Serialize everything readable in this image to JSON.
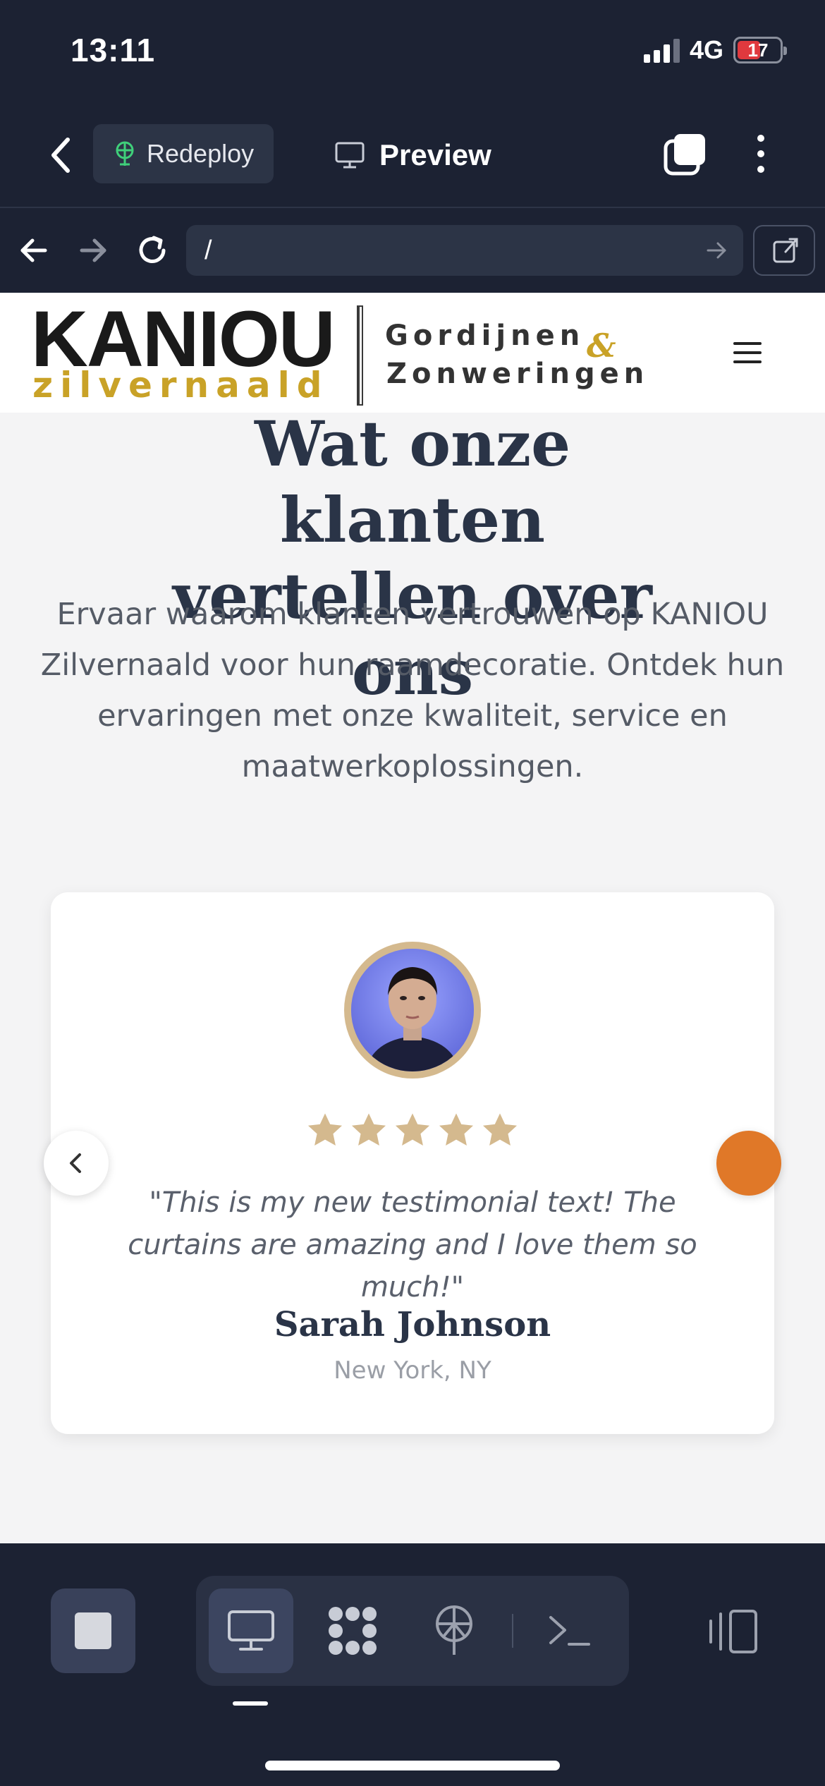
{
  "status_bar": {
    "time": "13:11",
    "network": "4G",
    "battery": "17"
  },
  "app_header": {
    "redeploy_label": "Redeploy",
    "preview_label": "Preview"
  },
  "url_bar": {
    "url": "/"
  },
  "site": {
    "logo": {
      "main": "KANIOU",
      "sub": "zilvernaald",
      "tagline_1": "Gordijnen",
      "ampersand": "&",
      "tagline_2": "Zonweringen"
    },
    "section_title": "Wat onze klanten vertellen over ons",
    "section_intro": "Ervaar waarom klanten vertrouwen op KANIOU Zilvernaald voor hun raamdecoratie. Ontdek hun ervaringen met onze kwaliteit, service en maatwerkoplossingen.",
    "testimonial": {
      "rating": 5,
      "max_rating": 5,
      "quote": "\"This is my new testimonial text! The curtains are amazing and I love them so much!\"",
      "name": "Sarah Johnson",
      "location": "New York, NY"
    },
    "colors": {
      "accent": "#e07828",
      "star": "#d4b98e",
      "heading": "#2a3447",
      "logo_gold": "#c9a227"
    }
  },
  "toolbar": {
    "icons": [
      "stop-icon",
      "desktop-icon",
      "apps-grid-icon",
      "deploy-icon",
      "terminal-icon",
      "panels-icon"
    ]
  }
}
